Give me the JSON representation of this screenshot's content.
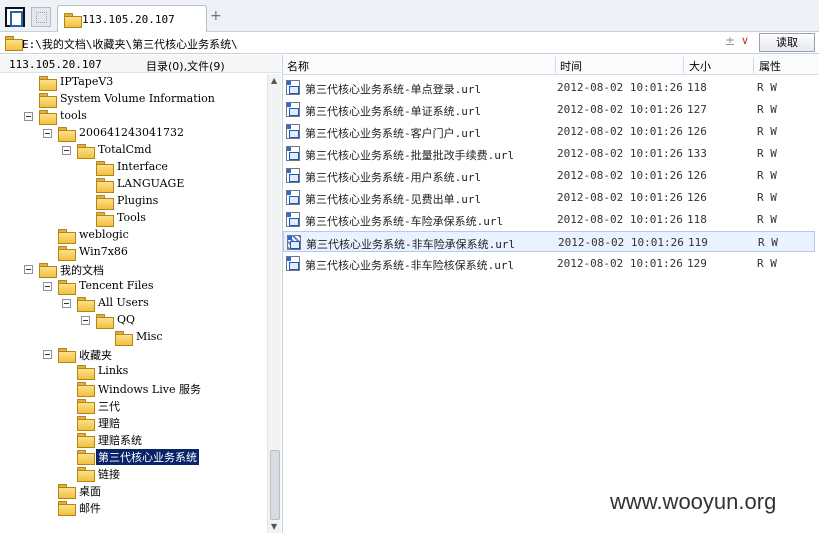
{
  "tab": {
    "title": "113.105.20.107"
  },
  "pathbar": {
    "path": "E:\\我的文档\\收藏夹\\第三代核心业务系统\\",
    "plus": "±",
    "chevron": "∨",
    "read_button": "读取"
  },
  "left_header": {
    "host": "113.105.20.107",
    "counts": "目录(0),文件(9)"
  },
  "tree": [
    {
      "label": "IPTapeV3",
      "toggle": false
    },
    {
      "label": "System Volume Information",
      "toggle": false
    },
    {
      "label": "tools",
      "toggle": true
    },
    {
      "label": "200641243041732",
      "toggle": true
    },
    {
      "label": "TotalCmd",
      "toggle": true
    },
    {
      "label": "Interface",
      "toggle": false
    },
    {
      "label": "LANGUAGE",
      "toggle": false
    },
    {
      "label": "Plugins",
      "toggle": false
    },
    {
      "label": "Tools",
      "toggle": false
    },
    {
      "label": "weblogic",
      "toggle": false
    },
    {
      "label": "Win7x86",
      "toggle": false
    },
    {
      "label": "我的文档",
      "toggle": true
    },
    {
      "label": "Tencent Files",
      "toggle": true
    },
    {
      "label": "All Users",
      "toggle": true
    },
    {
      "label": "QQ",
      "toggle": true
    },
    {
      "label": "Misc",
      "toggle": false
    },
    {
      "label": "收藏夹",
      "toggle": true
    },
    {
      "label": "Links",
      "toggle": false
    },
    {
      "label": "Windows Live 服务",
      "toggle": false
    },
    {
      "label": "三代",
      "toggle": false
    },
    {
      "label": "理赔",
      "toggle": false
    },
    {
      "label": "理赔系统",
      "toggle": false
    },
    {
      "label": "第三代核心业务系统",
      "toggle": false,
      "selected": true
    },
    {
      "label": "链接",
      "toggle": false
    },
    {
      "label": "桌面",
      "toggle": false
    },
    {
      "label": "邮件",
      "toggle": false
    }
  ],
  "columns": {
    "name": "名称",
    "time": "时间",
    "size": "大小",
    "attr": "属性"
  },
  "files": [
    {
      "name": "第三代核心业务系统-单点登录.url",
      "time": "2012-08-02 10:01:26",
      "size": "118",
      "attr": "R W"
    },
    {
      "name": "第三代核心业务系统-单证系统.url",
      "time": "2012-08-02 10:01:26",
      "size": "127",
      "attr": "R W"
    },
    {
      "name": "第三代核心业务系统-客户门户.url",
      "time": "2012-08-02 10:01:26",
      "size": "126",
      "attr": "R W"
    },
    {
      "name": "第三代核心业务系统-批量批改手续费.url",
      "time": "2012-08-02 10:01:26",
      "size": "133",
      "attr": "R W"
    },
    {
      "name": "第三代核心业务系统-用户系统.url",
      "time": "2012-08-02 10:01:26",
      "size": "126",
      "attr": "R W"
    },
    {
      "name": "第三代核心业务系统-见费出单.url",
      "time": "2012-08-02 10:01:26",
      "size": "126",
      "attr": "R W"
    },
    {
      "name": "第三代核心业务系统-车险承保系统.url",
      "time": "2012-08-02 10:01:26",
      "size": "118",
      "attr": "R W"
    },
    {
      "name": "第三代核心业务系统-非车险承保系统.url",
      "time": "2012-08-02 10:01:26",
      "size": "119",
      "attr": "R W",
      "selected": true
    },
    {
      "name": "第三代核心业务系统-非车险核保系统.url",
      "time": "2012-08-02 10:01:26",
      "size": "129",
      "attr": "R W"
    }
  ],
  "watermark": "www.wooyun.org"
}
